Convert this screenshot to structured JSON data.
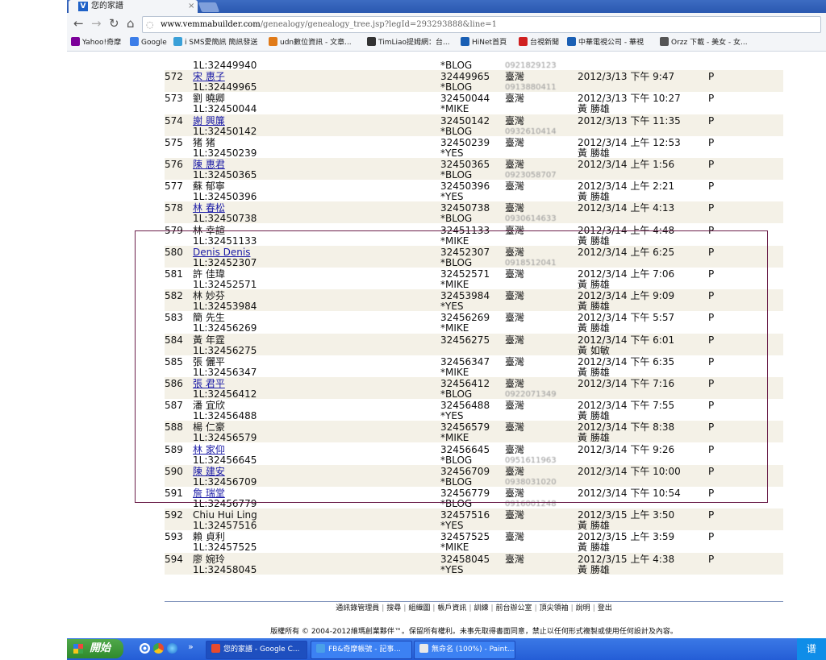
{
  "browser": {
    "tab_title": "您的家譜",
    "tab_close": "×",
    "url_host": "www.vemmabuilder.com",
    "url_path": "/genealogy/genealogy_tree.jsp?legId=293293888&line=1",
    "bookmarks": [
      {
        "label": "Yahoo!奇摩",
        "color": "#7b0099"
      },
      {
        "label": "Google",
        "color": "#3b7de8"
      },
      {
        "label": "i SMS愛簡訊 簡訊發送",
        "color": "#3aa0d8"
      },
      {
        "label": "udn數位資訊 - 文章...",
        "color": "#e07a18"
      },
      {
        "label": "TimLiao提姆網：台...",
        "color": "#333333"
      },
      {
        "label": "HiNet首頁",
        "color": "#1a5fb4"
      },
      {
        "label": "台視新聞",
        "color": "#d02020"
      },
      {
        "label": "中華電視公司 - 華視",
        "color": "#1a5fb4"
      },
      {
        "label": "Orzz 下載 - 美女 - 女...",
        "color": "#555555"
      }
    ]
  },
  "rows": [
    {
      "num": "",
      "name": "",
      "sub": "1L:32449940",
      "code": "",
      "code2": "*BLOG",
      "loc": "",
      "phone": "0921829123",
      "date": "",
      "by": "",
      "flag": "",
      "link": false
    },
    {
      "num": "572",
      "name": "宋 惠子",
      "sub": "1L:32449965",
      "code": "32449965",
      "code2": "*BLOG",
      "loc": "臺灣",
      "phone": "0913880411",
      "date": "2012/3/13 下午 9:47",
      "by": "",
      "flag": "P",
      "link": true
    },
    {
      "num": "573",
      "name": "劉 曉卿",
      "sub": "1L:32450044",
      "code": "32450044",
      "code2": "*MIKE",
      "loc": "臺灣",
      "phone": "",
      "date": "2012/3/13 下午 10:27",
      "by": "黃 勝雄",
      "flag": "P",
      "link": false
    },
    {
      "num": "574",
      "name": "謝 興簾",
      "sub": "1L:32450142",
      "code": "32450142",
      "code2": "*BLOG",
      "loc": "臺灣",
      "phone": "0932610414",
      "date": "2012/3/13 下午 11:35",
      "by": "",
      "flag": "P",
      "link": true
    },
    {
      "num": "575",
      "name": "猪 猪",
      "sub": "1L:32450239",
      "code": "32450239",
      "code2": "*YES",
      "loc": "臺灣",
      "phone": "",
      "date": "2012/3/14 上午 12:53",
      "by": "黃 勝雄",
      "flag": "P",
      "link": false
    },
    {
      "num": "576",
      "name": "陳 惠君",
      "sub": "1L:32450365",
      "code": "32450365",
      "code2": "*BLOG",
      "loc": "臺灣",
      "phone": "0923058707",
      "date": "2012/3/14 上午 1:56",
      "by": "",
      "flag": "P",
      "link": true
    },
    {
      "num": "577",
      "name": "蘇 郁寧",
      "sub": "1L:32450396",
      "code": "32450396",
      "code2": "*YES",
      "loc": "臺灣",
      "phone": "",
      "date": "2012/3/14 上午 2:21",
      "by": "黃 勝雄",
      "flag": "P",
      "link": false
    },
    {
      "num": "578",
      "name": "林 春松",
      "sub": "1L:32450738",
      "code": "32450738",
      "code2": "*BLOG",
      "loc": "臺灣",
      "phone": "0930614633",
      "date": "2012/3/14 上午 4:13",
      "by": "",
      "flag": "P",
      "link": true
    },
    {
      "num": "579",
      "name": "林 幸諠",
      "sub": "1L:32451133",
      "code": "32451133",
      "code2": "*MIKE",
      "loc": "臺灣",
      "phone": "",
      "date": "2012/3/14 上午 4:48",
      "by": "黃 勝雄",
      "flag": "P",
      "link": false
    },
    {
      "num": "580",
      "name": "Denis Denis",
      "sub": "1L:32452307",
      "code": "32452307",
      "code2": "*BLOG",
      "loc": "臺灣",
      "phone": "0918512041",
      "date": "2012/3/14 上午 6:25",
      "by": "",
      "flag": "P",
      "link": true
    },
    {
      "num": "581",
      "name": "許 佳瑋",
      "sub": "1L:32452571",
      "code": "32452571",
      "code2": "*MIKE",
      "loc": "臺灣",
      "phone": "",
      "date": "2012/3/14 上午 7:06",
      "by": "黃 勝雄",
      "flag": "P",
      "link": false
    },
    {
      "num": "582",
      "name": "林 妙芬",
      "sub": "1L:32453984",
      "code": "32453984",
      "code2": "*YES",
      "loc": "臺灣",
      "phone": "",
      "date": "2012/3/14 上午 9:09",
      "by": "黃 勝雄",
      "flag": "P",
      "link": false
    },
    {
      "num": "583",
      "name": "簡 先生",
      "sub": "1L:32456269",
      "code": "32456269",
      "code2": "*MIKE",
      "loc": "臺灣",
      "phone": "",
      "date": "2012/3/14 下午 5:57",
      "by": "黃 勝雄",
      "flag": "P",
      "link": false
    },
    {
      "num": "584",
      "name": "黃 年霆",
      "sub": "1L:32456275",
      "code": "32456275",
      "code2": "",
      "loc": "臺灣",
      "phone": "",
      "date": "2012/3/14 下午 6:01",
      "by": "黃 如敏",
      "flag": "P",
      "link": false
    },
    {
      "num": "585",
      "name": "張 儷平",
      "sub": "1L:32456347",
      "code": "32456347",
      "code2": "*MIKE",
      "loc": "臺灣",
      "phone": "",
      "date": "2012/3/14 下午 6:35",
      "by": "黃 勝雄",
      "flag": "P",
      "link": false
    },
    {
      "num": "586",
      "name": "張 君平",
      "sub": "1L:32456412",
      "code": "32456412",
      "code2": "*BLOG",
      "loc": "臺灣",
      "phone": "0922071349",
      "date": "2012/3/14 下午 7:16",
      "by": "",
      "flag": "P",
      "link": true
    },
    {
      "num": "587",
      "name": "潘 宜欣",
      "sub": "1L:32456488",
      "code": "32456488",
      "code2": "*YES",
      "loc": "臺灣",
      "phone": "",
      "date": "2012/3/14 下午 7:55",
      "by": "黃 勝雄",
      "flag": "P",
      "link": false
    },
    {
      "num": "588",
      "name": "楊 仁豪",
      "sub": "1L:32456579",
      "code": "32456579",
      "code2": "*MIKE",
      "loc": "臺灣",
      "phone": "",
      "date": "2012/3/14 下午 8:38",
      "by": "黃 勝雄",
      "flag": "P",
      "link": false
    },
    {
      "num": "589",
      "name": "林 家仰",
      "sub": "1L:32456645",
      "code": "32456645",
      "code2": "*BLOG",
      "loc": "臺灣",
      "phone": "0951611963",
      "date": "2012/3/14 下午 9:26",
      "by": "",
      "flag": "P",
      "link": true
    },
    {
      "num": "590",
      "name": "陳 建安",
      "sub": "1L:32456709",
      "code": "32456709",
      "code2": "*BLOG",
      "loc": "臺灣",
      "phone": "0938031020",
      "date": "2012/3/14 下午 10:00",
      "by": "",
      "flag": "P",
      "link": true
    },
    {
      "num": "591",
      "name": "詹 瑞堂",
      "sub": "1L:32456779",
      "code": "32456779",
      "code2": "*BLOG",
      "loc": "臺灣",
      "phone": "0916001248",
      "date": "2012/3/14 下午 10:54",
      "by": "",
      "flag": "P",
      "link": true
    },
    {
      "num": "592",
      "name": "Chiu Hui Ling",
      "sub": "1L:32457516",
      "code": "32457516",
      "code2": "*YES",
      "loc": "臺灣",
      "phone": "",
      "date": "2012/3/15 上午 3:50",
      "by": "黃 勝雄",
      "flag": "P",
      "link": false
    },
    {
      "num": "593",
      "name": "賴 貞利",
      "sub": "1L:32457525",
      "code": "32457525",
      "code2": "*MIKE",
      "loc": "臺灣",
      "phone": "",
      "date": "2012/3/15 上午 3:59",
      "by": "黃 勝雄",
      "flag": "P",
      "link": false
    },
    {
      "num": "594",
      "name": "廖 婉玲",
      "sub": "1L:32458045",
      "code": "32458045",
      "code2": "*YES",
      "loc": "臺灣",
      "phone": "",
      "date": "2012/3/15 上午 4:38",
      "by": "黃 勝雄",
      "flag": "P",
      "link": false
    }
  ],
  "footer": {
    "links": [
      "通訊錄管理員",
      "搜尋",
      "組織圖",
      "帳戶資訊",
      "訓練",
      "前台辦公室",
      "頂尖領袖",
      "說明",
      "登出"
    ],
    "copyright": "版權所有 © 2004-2012維瑪創業夥伴™。保留所有權利。未事先取得書面同意，禁止以任何形式複製或使用任何設計及內容。"
  },
  "taskbar": {
    "start_label": "開始",
    "more": "»",
    "tasks": [
      {
        "label": "您的家譜 - Google C...",
        "color": "#e84a2c"
      },
      {
        "label": "FB&奇摩帳號 - 記事...",
        "color": "#4aa0e8"
      },
      {
        "label": "無命名 (100%) - Paint...",
        "color": "#e8e8e8"
      }
    ],
    "tray": "谱"
  }
}
